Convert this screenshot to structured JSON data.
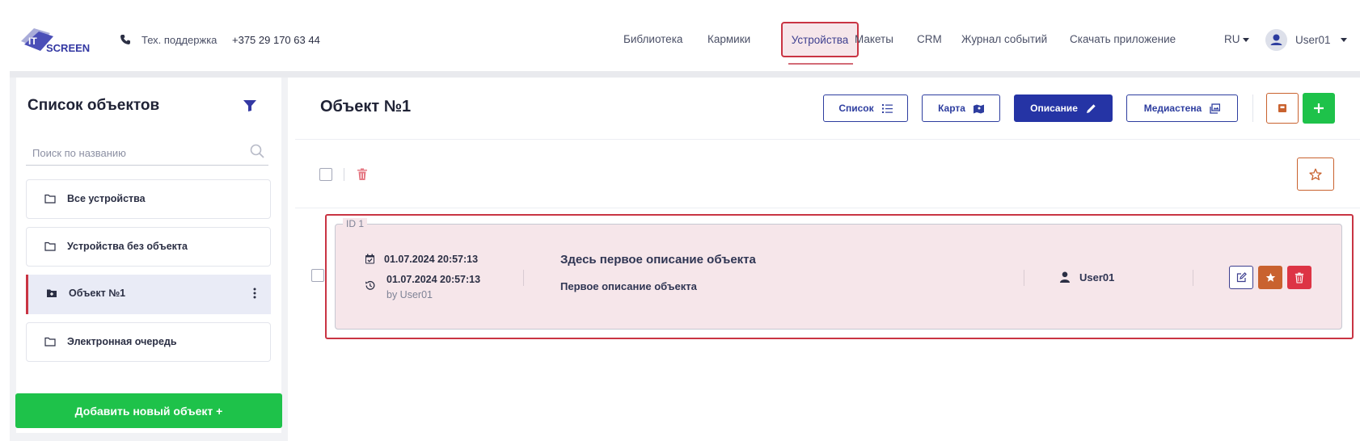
{
  "header": {
    "logo": {
      "top": "IT",
      "bottom": "SCREEN"
    },
    "support_label": "Тех. поддержка",
    "support_phone": "+375 29 170 63 44",
    "nav": [
      {
        "label": "Библиотека"
      },
      {
        "label": "Кармики"
      },
      {
        "label": "Устройства",
        "active": true
      },
      {
        "label": "Макеты"
      },
      {
        "label": "CRM"
      },
      {
        "label": "Журнал событий"
      },
      {
        "label": "Скачать приложение"
      }
    ],
    "language": "RU",
    "user": "User01"
  },
  "sidebar": {
    "title": "Список объектов",
    "search_placeholder": "Поиск по названию",
    "items": [
      {
        "label": "Все устройства"
      },
      {
        "label": "Устройства без объекта"
      },
      {
        "label": "Объект №1",
        "active": true
      },
      {
        "label": "Электронная очередь"
      }
    ],
    "add_button": "Добавить новый объект +"
  },
  "main": {
    "title": "Объект №1",
    "view_buttons": [
      {
        "label": "Список",
        "icon": "list-icon"
      },
      {
        "label": "Карта",
        "icon": "map-icon"
      },
      {
        "label": "Описание",
        "icon": "pencil-icon",
        "active": true
      },
      {
        "label": "Медиастена",
        "icon": "media-wall-icon"
      }
    ],
    "card": {
      "id_label": "ID 1",
      "created": "01.07.2024 20:57:13",
      "updated": "01.07.2024 20:57:13",
      "updated_by": "by User01",
      "description_title": "Здесь первое описание объекта",
      "description_text": "Первое описание объекта",
      "owner": "User01"
    }
  },
  "colors": {
    "accent_blue": "#2534a5",
    "green": "#1ec24a",
    "red": "#c93443",
    "orange": "#c9622f",
    "card_bg": "#f6e6ea"
  }
}
